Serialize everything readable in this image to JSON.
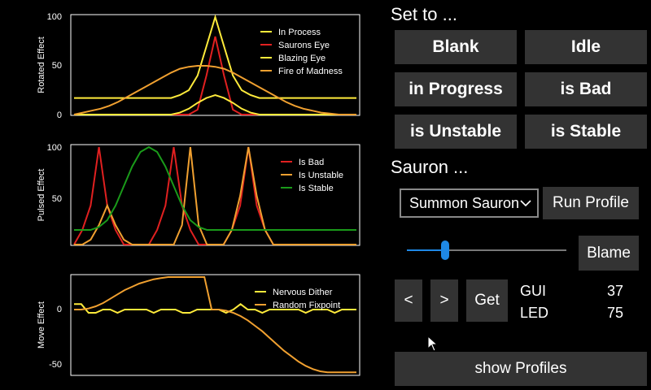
{
  "charts": {
    "rotated": {
      "ylabel": "Rotated Effect",
      "yticks": [
        "100",
        "50",
        "0"
      ],
      "legend": [
        {
          "name": "In Process",
          "color": "#ffeb3b"
        },
        {
          "name": "Saurons Eye",
          "color": "#e02020"
        },
        {
          "name": "Blazing Eye",
          "color": "#ffeb3b"
        },
        {
          "name": "Fire of Madness",
          "color": "#f0a030"
        }
      ]
    },
    "pulsed": {
      "ylabel": "Pulsed Effect",
      "yticks": [
        "100",
        "50"
      ],
      "legend": [
        {
          "name": "Is Bad",
          "color": "#e02020"
        },
        {
          "name": "Is Unstable",
          "color": "#f0a030"
        },
        {
          "name": "Is Stable",
          "color": "#1a9a1a"
        }
      ]
    },
    "move": {
      "ylabel": "Move Effect",
      "yticks": [
        "0",
        "-50"
      ],
      "legend": [
        {
          "name": "Nervous Dither",
          "color": "#ffeb3b"
        },
        {
          "name": "Random Fixpoint",
          "color": "#f0a030"
        }
      ]
    }
  },
  "chart_data": [
    {
      "type": "line",
      "ylabel": "Rotated Effect",
      "ylim": [
        0,
        100
      ],
      "series": [
        {
          "name": "In Process",
          "values": [
            17,
            17,
            17,
            17,
            17,
            17,
            17,
            17,
            17,
            17,
            17,
            17,
            20,
            25,
            40,
            70,
            100,
            70,
            40,
            25,
            20,
            17,
            17,
            17,
            17,
            17,
            17,
            17,
            17,
            17,
            17,
            17,
            17
          ]
        },
        {
          "name": "Saurons Eye",
          "values": [
            0,
            0,
            0,
            0,
            0,
            0,
            0,
            0,
            0,
            0,
            0,
            0,
            0,
            0,
            5,
            40,
            80,
            40,
            5,
            0,
            0,
            0,
            0,
            0,
            0,
            0,
            0,
            0,
            0,
            0,
            0,
            0,
            0
          ]
        },
        {
          "name": "Blazing Eye",
          "values": [
            0,
            0,
            0,
            0,
            0,
            0,
            0,
            0,
            0,
            0,
            0,
            0,
            2,
            6,
            12,
            17,
            20,
            17,
            12,
            6,
            2,
            0,
            0,
            0,
            0,
            0,
            0,
            0,
            0,
            0,
            0,
            0,
            0
          ]
        },
        {
          "name": "Fire of Madness",
          "values": [
            0,
            2,
            4,
            6,
            9,
            13,
            18,
            23,
            28,
            33,
            38,
            43,
            47,
            49,
            50,
            50,
            49,
            47,
            43,
            38,
            33,
            28,
            23,
            18,
            13,
            9,
            6,
            4,
            2,
            1,
            0,
            0,
            0
          ]
        }
      ]
    },
    {
      "type": "line",
      "ylabel": "Pulsed Effect",
      "ylim": [
        0,
        100
      ],
      "series": [
        {
          "name": "Is Bad",
          "values": [
            0,
            15,
            40,
            100,
            40,
            15,
            0,
            0,
            0,
            0,
            15,
            40,
            100,
            40,
            15,
            0,
            0,
            0,
            0,
            15,
            40,
            100,
            40,
            15,
            0,
            0,
            0,
            0,
            0,
            0,
            0,
            0,
            0,
            0,
            0
          ]
        },
        {
          "name": "Is Unstable",
          "values": [
            0,
            0,
            5,
            20,
            40,
            20,
            5,
            0,
            0,
            0,
            0,
            0,
            0,
            20,
            100,
            20,
            0,
            0,
            0,
            15,
            50,
            100,
            50,
            15,
            0,
            0,
            0,
            0,
            0,
            0,
            0,
            0,
            0,
            0,
            0
          ]
        },
        {
          "name": "Is Stable",
          "values": [
            15,
            15,
            15,
            18,
            25,
            40,
            60,
            80,
            95,
            100,
            95,
            80,
            60,
            40,
            25,
            18,
            15,
            15,
            15,
            15,
            15,
            15,
            15,
            15,
            15,
            15,
            15,
            15,
            15,
            15,
            15,
            15,
            15,
            15,
            15
          ]
        }
      ]
    },
    {
      "type": "line",
      "ylabel": "Move Effect",
      "ylim": [
        -60,
        30
      ],
      "series": [
        {
          "name": "Nervous Dither",
          "values": [
            5,
            5,
            -3,
            -3,
            0,
            0,
            -3,
            0,
            0,
            0,
            0,
            -3,
            0,
            0,
            0,
            -3,
            -3,
            0,
            0,
            0,
            0,
            -3,
            0,
            5,
            0,
            0,
            -3,
            0,
            0,
            0,
            0,
            0,
            -3,
            0,
            0,
            0,
            -3,
            0,
            0,
            0
          ]
        },
        {
          "name": "Random Fixpoint",
          "values": [
            0,
            0,
            1,
            3,
            6,
            10,
            14,
            18,
            21,
            24,
            26,
            28,
            29,
            30,
            30,
            30,
            30,
            30,
            30,
            0,
            0,
            -1,
            -3,
            -6,
            -10,
            -15,
            -20,
            -26,
            -32,
            -38,
            -43,
            -48,
            -52,
            -55,
            -57,
            -58,
            -58,
            -58,
            -58,
            -58
          ]
        }
      ]
    }
  ],
  "controls": {
    "set_to_title": "Set to ...",
    "buttons": {
      "blank": "Blank",
      "idle": "Idle",
      "in_progress": "in Progress",
      "is_bad": "is Bad",
      "is_unstable": "is Unstable",
      "is_stable": "is Stable"
    },
    "sauron_title": "Sauron ...",
    "profile_select_value": "Summon Sauron",
    "run_profile": "Run Profile",
    "slider_value": 0.25,
    "blame": "Blame",
    "prev": "<",
    "next": ">",
    "get": "Get",
    "gui_label": "GUI",
    "gui_value": "37",
    "led_label": "LED",
    "led_value": "75",
    "show_profiles": "show Profiles"
  },
  "colors": {
    "button_bg": "#333333",
    "slider_blue": "#1e88e5",
    "yellow": "#ffeb3b",
    "red": "#e02020",
    "orange": "#f0a030",
    "green": "#1a9a1a"
  }
}
